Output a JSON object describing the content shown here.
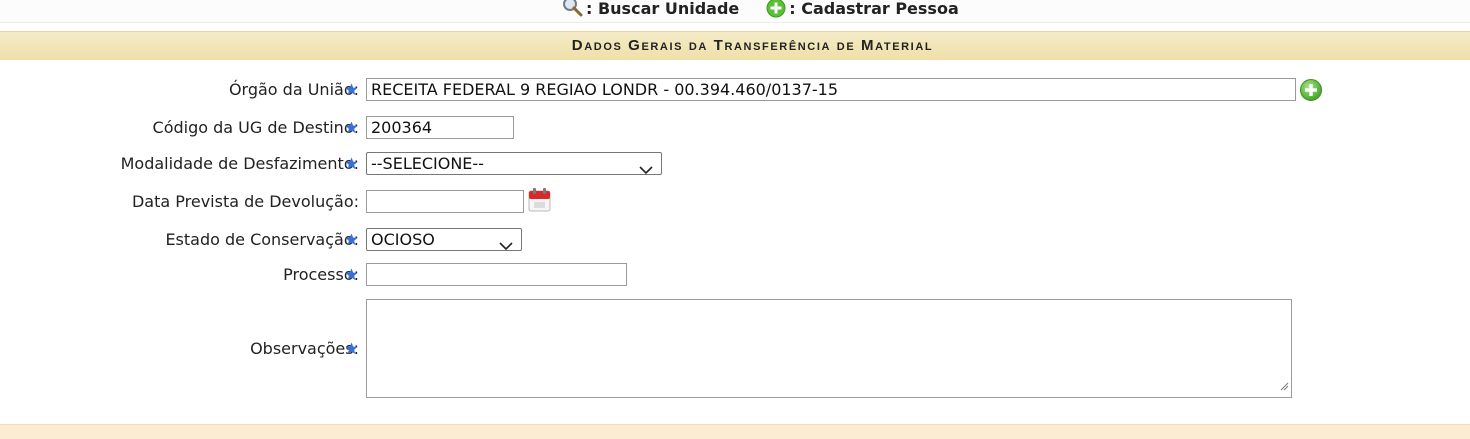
{
  "legend": {
    "search_unit_label": ": Buscar Unidade",
    "register_person_label": ": Cadastrar Pessoa"
  },
  "section": {
    "title": "Dados Gerais da Transferência de Material"
  },
  "form": {
    "orgao": {
      "label": "Órgão da União:",
      "value": "RECEITA FEDERAL 9 REGIAO LONDR - 00.394.460/0137-15"
    },
    "codigo_ug": {
      "label": "Código da UG de Destino:",
      "value": "200364"
    },
    "modalidade": {
      "label": "Modalidade de Desfazimento:",
      "selected": "--SELECIONE--"
    },
    "data_prevista": {
      "label": "Data Prevista de Devolução:",
      "value": ""
    },
    "estado": {
      "label": "Estado de Conservação:",
      "selected": "OCIOSO"
    },
    "processo": {
      "label": "Processo:",
      "value": ""
    },
    "observacoes": {
      "label": "Observações:",
      "value": ""
    }
  },
  "icons": {
    "required": "required-star-icon",
    "add": "add-green-plus-icon",
    "calendar": "calendar-icon",
    "search": "magnifier-icon"
  },
  "colors": {
    "header_bg": "#efe0a9",
    "footer_bg": "#fbecd3",
    "star_blue": "#3a6fd8",
    "plus_green": "#5cbf3a"
  }
}
